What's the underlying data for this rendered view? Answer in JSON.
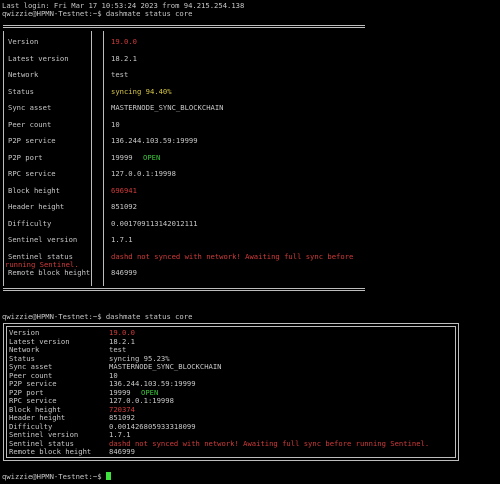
{
  "terminal": {
    "last_login": "Last login: Fri Mar 17 10:53:24 2023 from 94.215.254.138",
    "prompt": "qwizzie@HPMN-Testnet:~$",
    "command1": "dashmate status core",
    "command2": "dashmate status core"
  },
  "table1": {
    "rows": [
      {
        "key": "Version",
        "value": "19.0.0",
        "color": "#d13a3a"
      },
      {
        "key": "Latest version",
        "value": "18.2.1",
        "color": "#c8c8c8"
      },
      {
        "key": "Network",
        "value": "test",
        "color": "#c8c8c8"
      },
      {
        "key": "Status",
        "value": "syncing 94.40%",
        "color": "#d6c646"
      },
      {
        "key": "Sync asset",
        "value": "MASTERNODE_SYNC_BLOCKCHAIN",
        "color": "#c8c8c8"
      },
      {
        "key": "Peer count",
        "value": "10",
        "color": "#c8c8c8"
      },
      {
        "key": "P2P service",
        "value": "136.244.103.59:19999",
        "color": "#c8c8c8"
      },
      {
        "key": "P2P port",
        "value": "19999",
        "extra": "OPEN",
        "color": "#c8c8c8"
      },
      {
        "key": "RPC service",
        "value": "127.0.0.1:19998",
        "color": "#c8c8c8"
      },
      {
        "key": "Block height",
        "value": "696941",
        "color": "#d13a3a"
      },
      {
        "key": "Header height",
        "value": "851092",
        "color": "#c8c8c8"
      },
      {
        "key": "Difficulty",
        "value": "0.001709113142012111",
        "color": "#c8c8c8"
      },
      {
        "key": "Sentinel version",
        "value": "1.7.1",
        "color": "#c8c8c8"
      },
      {
        "key": "Sentinel status",
        "value": "dashd not synced with network! Awaiting full sync before",
        "color": "#d13a3a"
      },
      {
        "key": "Remote block height",
        "value": "846999",
        "color": "#c8c8c8"
      }
    ],
    "sentinel_wrap": "running Sentinel."
  },
  "table2": {
    "rows": [
      {
        "key": "Version",
        "value": "19.0.0",
        "color": "#d13a3a"
      },
      {
        "key": "Latest version",
        "value": "18.2.1",
        "color": "#c8c8c8"
      },
      {
        "key": "Network",
        "value": "test",
        "color": "#c8c8c8"
      },
      {
        "key": "Status",
        "value": "syncing 95.23%",
        "color": "#c8c8c8"
      },
      {
        "key": "Sync asset",
        "value": "MASTERNODE_SYNC_BLOCKCHAIN",
        "color": "#c8c8c8"
      },
      {
        "key": "Peer count",
        "value": "10",
        "color": "#c8c8c8"
      },
      {
        "key": "P2P service",
        "value": "136.244.103.59:19999",
        "color": "#c8c8c8"
      },
      {
        "key": "P2P port",
        "value": "19999",
        "extra": "OPEN",
        "color": "#c8c8c8"
      },
      {
        "key": "RPC service",
        "value": "127.0.0.1:19998",
        "color": "#c8c8c8"
      },
      {
        "key": "Block height",
        "value": "720374",
        "color": "#d13a3a"
      },
      {
        "key": "Header height",
        "value": "851092",
        "color": "#c8c8c8"
      },
      {
        "key": "Difficulty",
        "value": "0.001426805933318099",
        "color": "#c8c8c8"
      },
      {
        "key": "Sentinel version",
        "value": "1.7.1",
        "color": "#c8c8c8"
      },
      {
        "key": "Sentinel status",
        "value": "dashd not synced with network! Awaiting full sync before running Sentinel.",
        "color": "#d13a3a"
      },
      {
        "key": "Remote block height",
        "value": "846999",
        "color": "#c8c8c8"
      }
    ]
  }
}
